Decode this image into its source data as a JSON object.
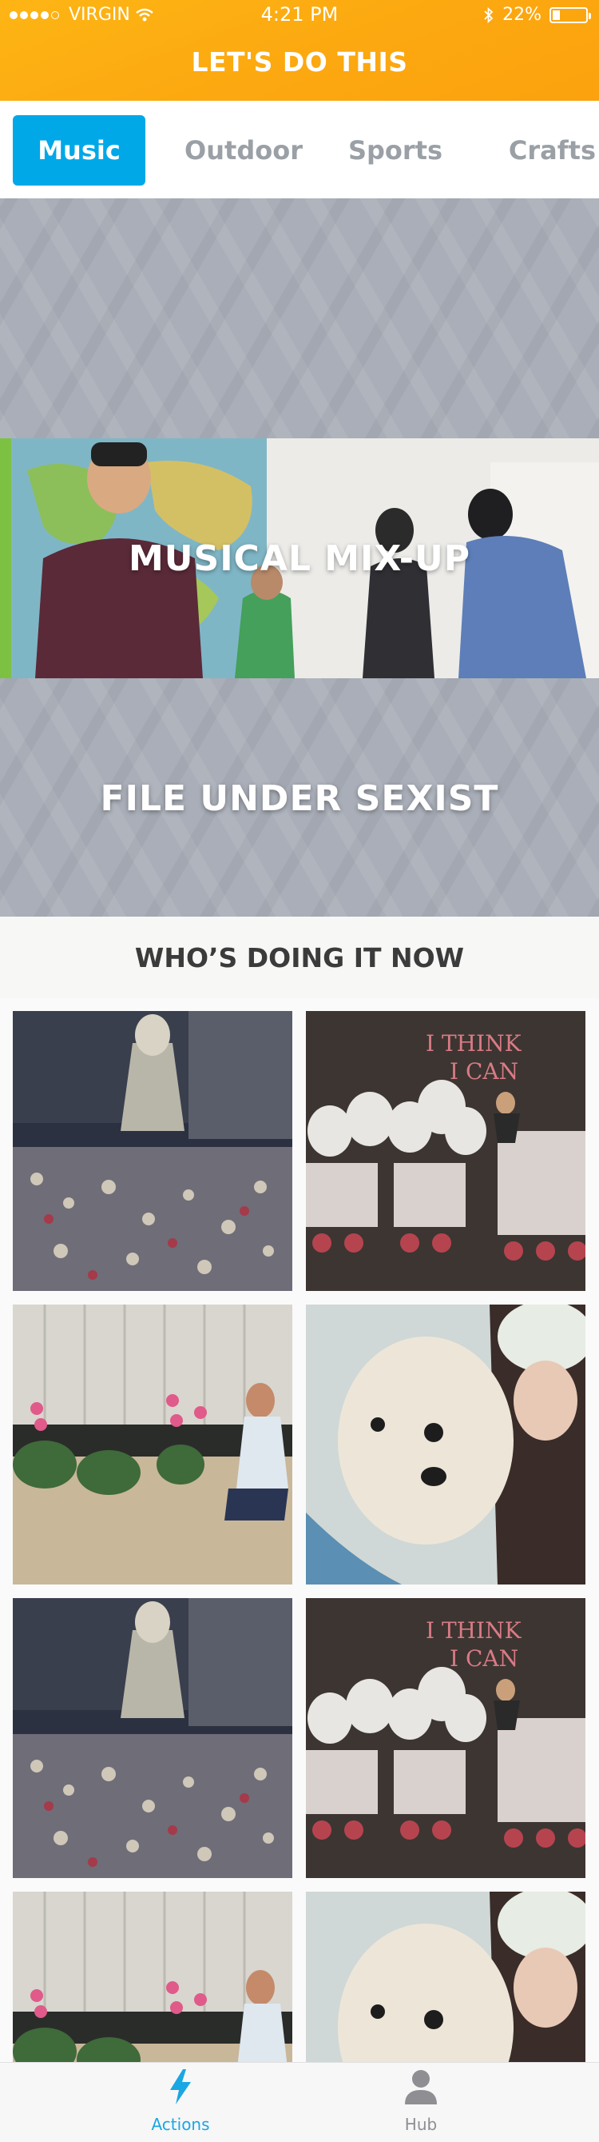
{
  "status_bar": {
    "carrier": "VIRGIN",
    "time": "4:21 PM",
    "battery": "22%",
    "battery_level": 0.22
  },
  "header": {
    "title": "LET'S DO THIS"
  },
  "tabs": [
    {
      "label": "Music",
      "active": true
    },
    {
      "label": "Outdoor",
      "active": false
    },
    {
      "label": "Sports",
      "active": false
    },
    {
      "label": "Crafts",
      "active": false
    }
  ],
  "actions": [
    {
      "title": ""
    },
    {
      "title": "MUSICAL MIX-UP"
    },
    {
      "title": "FILE UNDER SEXIST"
    }
  ],
  "section": {
    "title": "WHO’S DOING IT NOW"
  },
  "tab_bar": {
    "items": [
      {
        "label": "Actions",
        "icon": "lightning-icon",
        "active": true
      },
      {
        "label": "Hub",
        "icon": "person-icon",
        "active": false
      }
    ]
  },
  "colors": {
    "header": "#fdb514",
    "active_tab": "#00a8e8",
    "card_gray": "#a9aeb8",
    "accent_green": "#7dc142",
    "tab_active_text": "#1aa7e3"
  }
}
